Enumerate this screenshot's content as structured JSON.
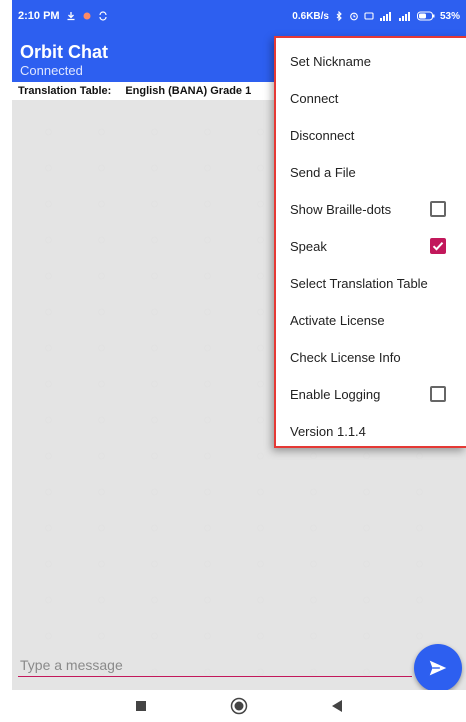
{
  "status_bar": {
    "time": "2:10 PM",
    "network_speed": "0.6KB/s",
    "battery": "53%"
  },
  "app_bar": {
    "title": "Orbit Chat",
    "subtitle": "Connected"
  },
  "translation_table": {
    "label": "Translation Table:",
    "value": "English (BANA) Grade 1"
  },
  "menu": {
    "items": [
      {
        "label": "Set Nickname"
      },
      {
        "label": "Connect"
      },
      {
        "label": "Disconnect"
      },
      {
        "label": "Send a File"
      },
      {
        "label": "Show Braille-dots",
        "checkbox": true,
        "checked": false
      },
      {
        "label": "Speak",
        "checkbox": true,
        "checked": true
      },
      {
        "label": "Select Translation Table"
      },
      {
        "label": "Activate License"
      },
      {
        "label": "Check License Info"
      },
      {
        "label": "Enable Logging",
        "checkbox": true,
        "checked": false
      },
      {
        "label": "Version 1.1.4"
      }
    ]
  },
  "composer": {
    "placeholder": "Type a message",
    "send_icon": "send-icon"
  },
  "nav_bar": {
    "icons": [
      "recents-square-icon",
      "home-circle-icon",
      "back-triangle-icon"
    ]
  },
  "colors": {
    "primary": "#2d5ff0",
    "accent": "#c2185b",
    "menu_border": "#e53935"
  }
}
